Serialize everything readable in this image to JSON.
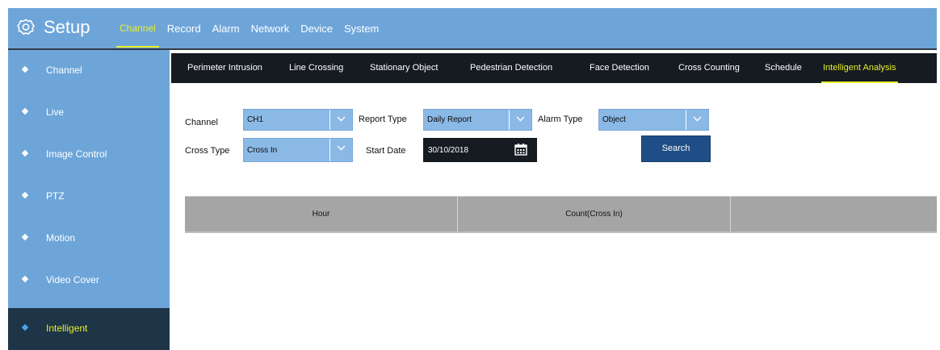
{
  "app": {
    "title": "Setup"
  },
  "top_menu": [
    {
      "label": "Channel",
      "active": true
    },
    {
      "label": "Record",
      "active": false
    },
    {
      "label": "Alarm",
      "active": false
    },
    {
      "label": "Network",
      "active": false
    },
    {
      "label": "Device",
      "active": false
    },
    {
      "label": "System",
      "active": false
    }
  ],
  "sidebar": {
    "items": [
      {
        "label": "Channel",
        "active": false
      },
      {
        "label": "Live",
        "active": false
      },
      {
        "label": "Image Control",
        "active": false
      },
      {
        "label": "PTZ",
        "active": false
      },
      {
        "label": "Motion",
        "active": false
      },
      {
        "label": "Video Cover",
        "active": false
      },
      {
        "label": "Intelligent",
        "active": true
      }
    ]
  },
  "subtabs": [
    {
      "label": "Perimeter Intrusion",
      "active": false
    },
    {
      "label": "Line Crossing",
      "active": false
    },
    {
      "label": "Stationary Object",
      "active": false
    },
    {
      "label": "Pedestrian Detection",
      "active": false
    },
    {
      "label": "Face Detection",
      "active": false
    },
    {
      "label": "Cross Counting",
      "active": false
    },
    {
      "label": "Schedule",
      "active": false
    },
    {
      "label": "Intelligent Analysis",
      "active": true
    }
  ],
  "form": {
    "channel": {
      "label": "Channel",
      "value": "CH1"
    },
    "report_type": {
      "label": "Report Type",
      "value": "Daily Report"
    },
    "alarm_type": {
      "label": "Alarm Type",
      "value": "Object"
    },
    "cross_type": {
      "label": "Cross Type",
      "value": "Cross In"
    },
    "start_date": {
      "label": "Start Date",
      "value": "30/10/2018"
    },
    "search_label": "Search"
  },
  "table": {
    "columns": [
      "Hour",
      "Count(Cross In)",
      ""
    ]
  },
  "colors": {
    "primary_blue": "#6ea5d9",
    "active_yellow": "#e6ef2a",
    "dark": "#151b20",
    "button_blue": "#1f4e86"
  }
}
